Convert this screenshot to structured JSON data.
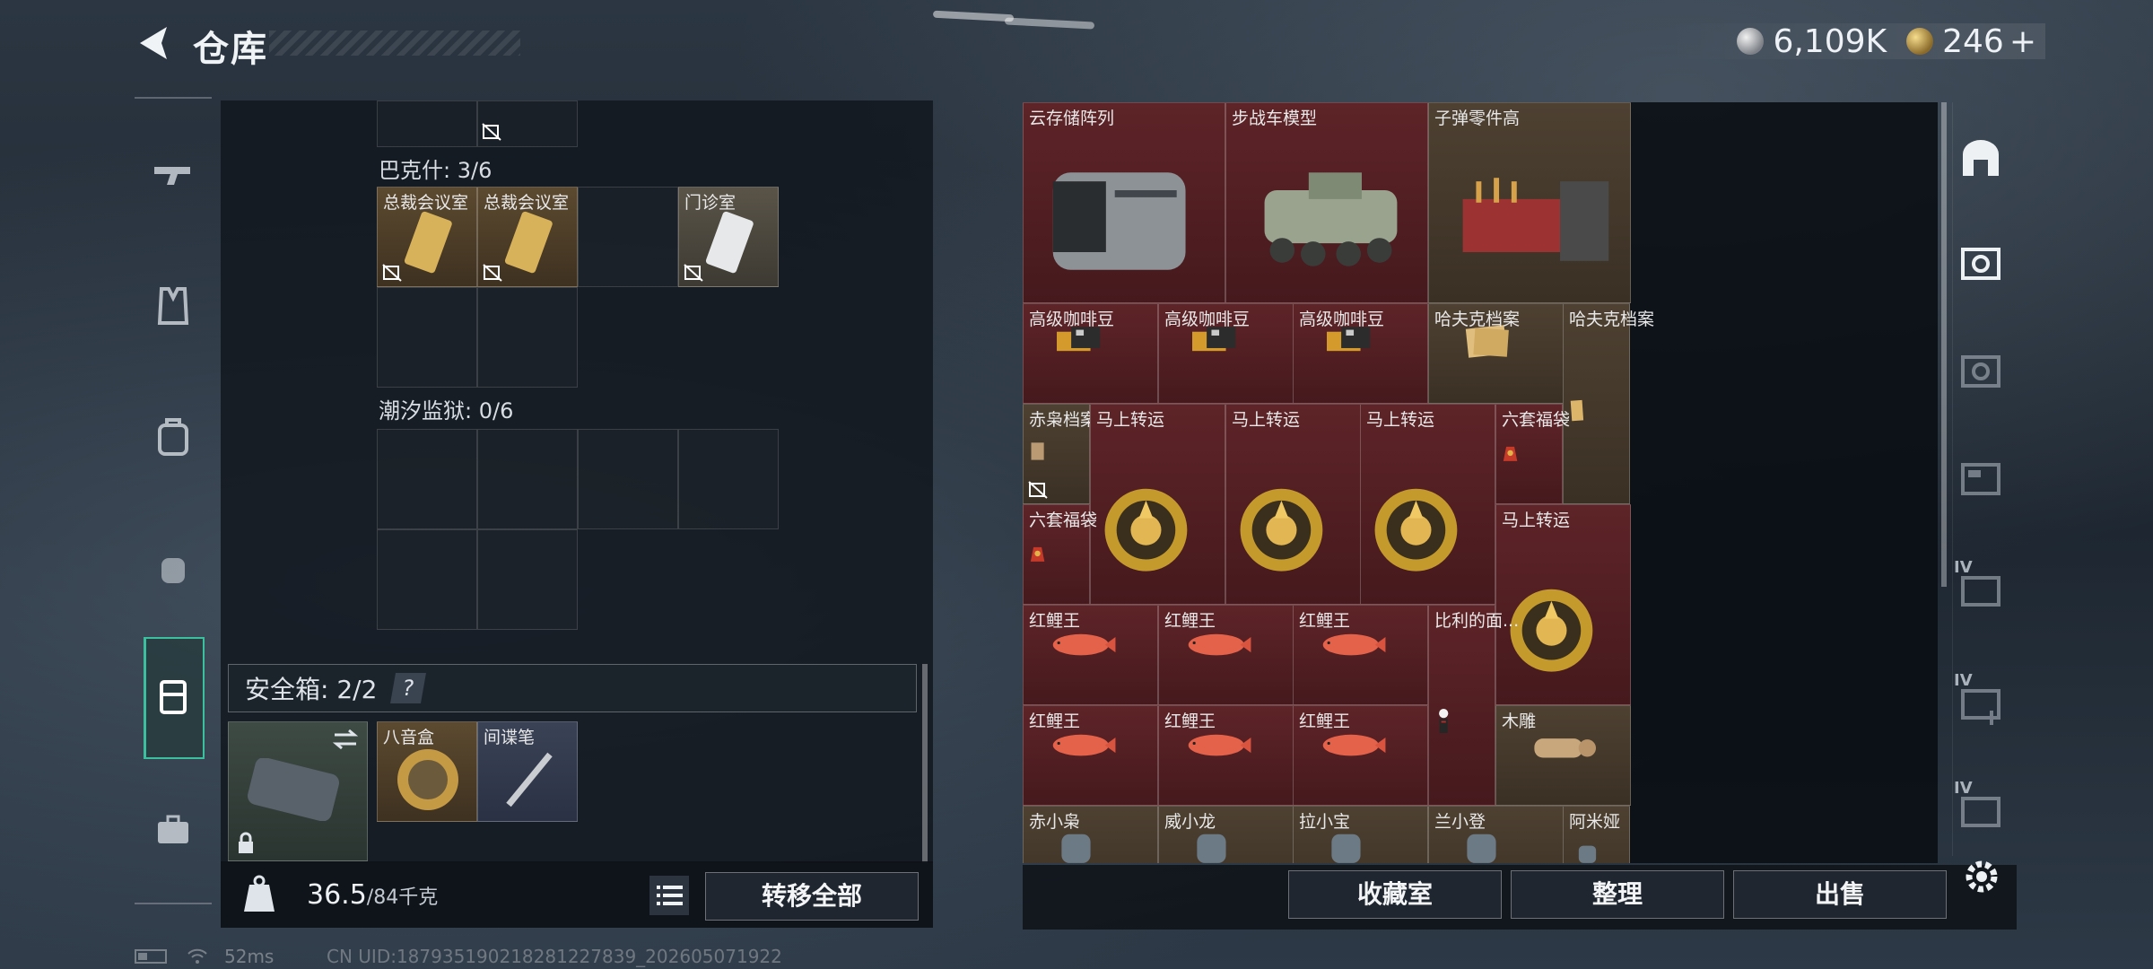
{
  "header": {
    "title": "仓库",
    "currency_silver": "6,109K",
    "currency_gold": "246",
    "gold_plus": "+"
  },
  "left_panel": {
    "sections": [
      {
        "label": "巴克什: 3/6"
      },
      {
        "label": "潮汐监狱: 0/6"
      }
    ],
    "bakeshi_items": [
      {
        "label": "总裁会议室"
      },
      {
        "label": "总裁会议室"
      },
      {
        "label": "门诊室"
      }
    ],
    "safebox": {
      "label": "安全箱: 2/2",
      "help": "?"
    },
    "safebox_items": [
      {
        "label": "八音盒"
      },
      {
        "label": "间谍笔"
      }
    ]
  },
  "bottom_bar": {
    "weight_current": "36.5",
    "weight_max": "/84千克",
    "transfer_all": "转移全部"
  },
  "stash_items": [
    {
      "label": "云存储阵列"
    },
    {
      "label": "步战车模型"
    },
    {
      "label": "子弹零件高"
    },
    {
      "label": "高级咖啡豆"
    },
    {
      "label": "高级咖啡豆"
    },
    {
      "label": "高级咖啡豆"
    },
    {
      "label": "哈夫克档案"
    },
    {
      "label": "哈夫克档案"
    },
    {
      "label": "赤枭档案"
    },
    {
      "label": "马上转运"
    },
    {
      "label": "马上转运"
    },
    {
      "label": "马上转运"
    },
    {
      "label": "六套福袋"
    },
    {
      "label": "六套福袋"
    },
    {
      "label": "马上转运"
    },
    {
      "label": "红鲤王"
    },
    {
      "label": "红鲤王"
    },
    {
      "label": "红鲤王"
    },
    {
      "label": "比利的面..."
    },
    {
      "label": "红鲤王"
    },
    {
      "label": "红鲤王"
    },
    {
      "label": "红鲤王"
    },
    {
      "label": "木雕"
    },
    {
      "label": "赤小枭"
    },
    {
      "label": "威小龙"
    },
    {
      "label": "拉小宝"
    },
    {
      "label": "兰小登"
    },
    {
      "label": "阿米娅"
    }
  ],
  "right_buttons": {
    "collection": "收藏室",
    "sort": "整理",
    "sell": "出售"
  },
  "right_nav": [
    "IV",
    "IV",
    "IV"
  ],
  "status": {
    "ping": "52ms",
    "uid": "CN UID:187935190218281227839_202605071922"
  },
  "colors": {
    "accent": "#3bbf9e",
    "red_tier": "#5c2326",
    "gold_tier": "#4e3e28"
  }
}
